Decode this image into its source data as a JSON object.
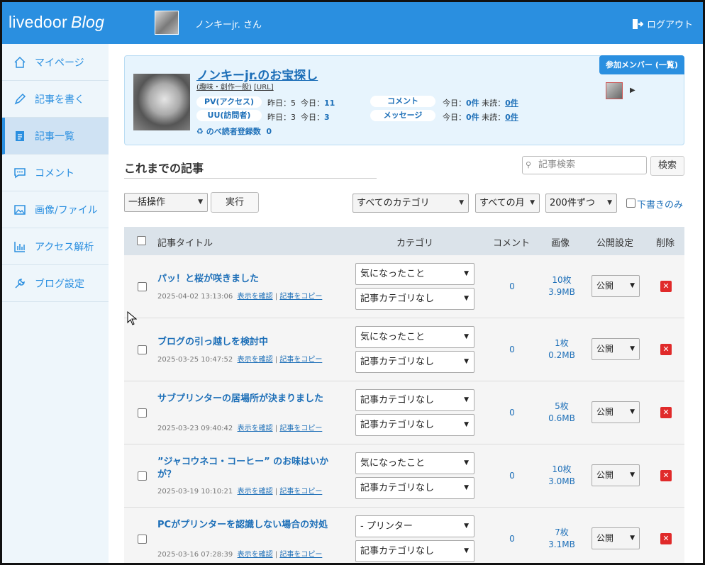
{
  "header": {
    "logo_main": "livedoor",
    "logo_sub": "Blog",
    "user": "ノンキーjr. さん",
    "logout": "ログアウト"
  },
  "sidebar": {
    "items": [
      {
        "label": "マイページ",
        "icon": "home-icon"
      },
      {
        "label": "記事を書く",
        "icon": "pencil-icon"
      },
      {
        "label": "記事一覧",
        "icon": "document-icon"
      },
      {
        "label": "コメント",
        "icon": "comment-icon"
      },
      {
        "label": "画像/ファイル",
        "icon": "image-icon"
      },
      {
        "label": "アクセス解析",
        "icon": "bar-chart-icon"
      },
      {
        "label": "ブログ設定",
        "icon": "wrench-icon"
      }
    ],
    "active_index": 2
  },
  "blog": {
    "title": "ノンキーjr.のお宝探し",
    "category": "(趣味・創作一般)",
    "url_label": "[URL]",
    "pv_label": "PV(アクセス)",
    "uu_label": "UU(訪問者)",
    "pv_yesterday": "昨日：5",
    "pv_today_label": "今日：",
    "pv_today_value": "11",
    "uu_yesterday": "昨日：3",
    "uu_today_label": "今日：",
    "uu_today_value": "3",
    "comment_label": "コメント",
    "message_label": "メッセージ",
    "comment_stat_prefix": "今日：",
    "comment_today": "0件",
    "comment_unread_label": "未読：",
    "comment_unread": "0件",
    "message_stat_prefix": "今日：",
    "message_today": "0件",
    "message_unread_label": "未読：",
    "message_unread": "0件",
    "readers_label": "のべ読者登録数",
    "readers_value": "0",
    "members_button": "参加メンバー (一覧)"
  },
  "section": {
    "title": "これまでの記事",
    "search_placeholder": "記事検索",
    "search_button": "検索"
  },
  "toolbar": {
    "bulk_action": "一括操作",
    "execute": "実行",
    "category_filter": "すべてのカテゴリ",
    "month_filter": "すべての月",
    "per_page": "200件ずつ",
    "drafts_only": "下書きのみ"
  },
  "table": {
    "headers": {
      "title": "記事タイトル",
      "category": "カテゴリ",
      "comments": "コメント",
      "images": "画像",
      "visibility": "公開設定",
      "delete": "削除"
    },
    "rows": [
      {
        "title": "パッ！と桜が咲きました",
        "date": "2025-04-02 13:13:06",
        "view": "表示を確認",
        "copy": "記事をコピー",
        "cat1": "気になったこと",
        "cat2": "記事カテゴリなし",
        "comments": "0",
        "images_count": "10枚",
        "images_size": "3.9MB",
        "visibility": "公開"
      },
      {
        "title": "ブログの引っ越しを検討中",
        "date": "2025-03-25 10:47:52",
        "view": "表示を確認",
        "copy": "記事をコピー",
        "cat1": "気になったこと",
        "cat2": "記事カテゴリなし",
        "comments": "0",
        "images_count": "1枚",
        "images_size": "0.2MB",
        "visibility": "公開"
      },
      {
        "title": "サブプリンターの居場所が決まりました",
        "date": "2025-03-23 09:40:42",
        "view": "表示を確認",
        "copy": "記事をコピー",
        "cat1": "記事カテゴリなし",
        "cat2": "記事カテゴリなし",
        "comments": "0",
        "images_count": "5枚",
        "images_size": "0.6MB",
        "visibility": "公開"
      },
      {
        "title": "”ジャコウネコ・コーヒー” のお味はいかが？",
        "date": "2025-03-19 10:10:21",
        "view": "表示を確認",
        "copy": "記事をコピー",
        "cat1": "気になったこと",
        "cat2": "記事カテゴリなし",
        "comments": "0",
        "images_count": "10枚",
        "images_size": "3.0MB",
        "visibility": "公開"
      },
      {
        "title": "PCがプリンターを認識しない場合の対処",
        "date": "2025-03-16 07:28:39",
        "view": "表示を確認",
        "copy": "記事をコピー",
        "cat1": "- プリンター",
        "cat2": "記事カテゴリなし",
        "comments": "0",
        "images_count": "7枚",
        "images_size": "3.1MB",
        "visibility": "公開"
      }
    ]
  },
  "colors": {
    "accent": "#2a8fe0",
    "link": "#1d6fb8",
    "delete": "#e02a2a"
  }
}
